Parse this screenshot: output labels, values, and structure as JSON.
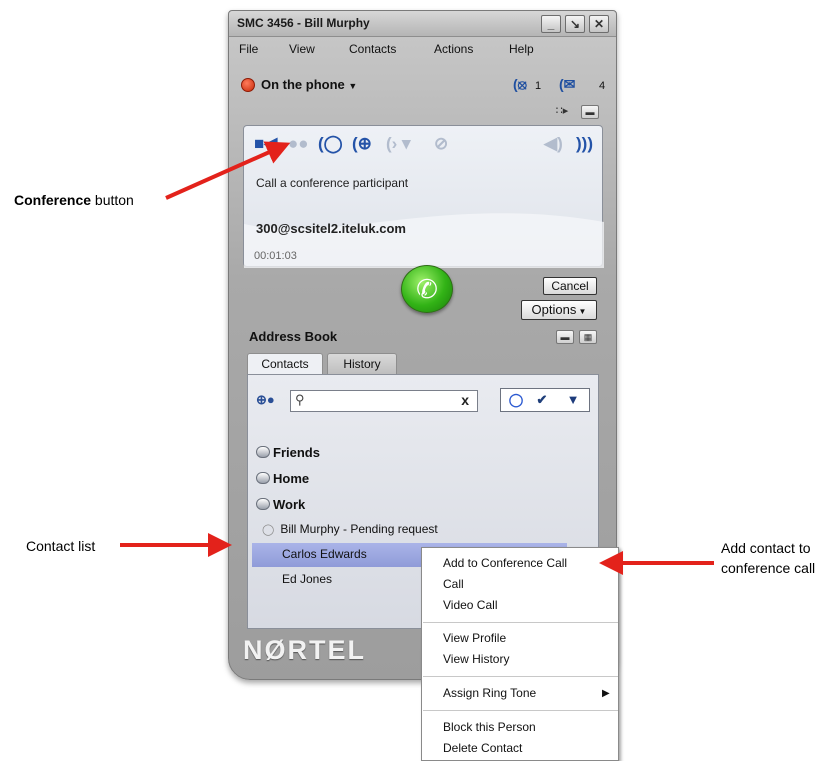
{
  "annotations": {
    "conference": {
      "bold": "Conference",
      "rest": " button"
    },
    "contact_list": "Contact list",
    "add_contact_line1": "Add contact to",
    "add_contact_line2": "conference call",
    "arrow_color": "#e3221b"
  },
  "window": {
    "title": "SMC 3456 - Bill Murphy",
    "controls": [
      "minimize-icon",
      "minimize-to-tray-icon",
      "close-icon"
    ]
  },
  "menu": {
    "items": [
      "File",
      "View",
      "Contacts",
      "Actions",
      "Help"
    ]
  },
  "status": {
    "label": "On the phone",
    "missed_calls": "1",
    "messages": "4",
    "accent": "#d6391b"
  },
  "call_panel": {
    "toolbar_icons": [
      "video-icon",
      "conference-icon",
      "hold-icon",
      "transfer-icon",
      "speaker-level-icon",
      "mute-microphone-icon",
      "volume-down-icon",
      "volume-up-icon"
    ],
    "label": "Call a conference participant",
    "address": "300@scsitel2.iteluk.com",
    "timer": "00:01:03",
    "cancel_label": "Cancel",
    "options_label": "Options"
  },
  "address_book": {
    "title": "Address Book",
    "tabs": [
      "Contacts",
      "History"
    ],
    "search_value": "",
    "clear_label": "x",
    "groups": [
      "Friends",
      "Home",
      "Work"
    ],
    "contacts": [
      {
        "name": "Bill Murphy - Pending request",
        "status": "pending"
      },
      {
        "name": "Carlos  Edwards",
        "status": "selected"
      },
      {
        "name": "Ed Jones",
        "status": "normal"
      }
    ],
    "selected_color": "#9ba6df"
  },
  "brand": "NØRTEL",
  "context_menu": {
    "group1": [
      "Add to Conference Call",
      "Call",
      "Video Call"
    ],
    "group2": [
      "View Profile",
      "View History"
    ],
    "group3": [
      "Assign Ring Tone"
    ],
    "group4": [
      "Block this Person",
      "Delete Contact"
    ]
  }
}
